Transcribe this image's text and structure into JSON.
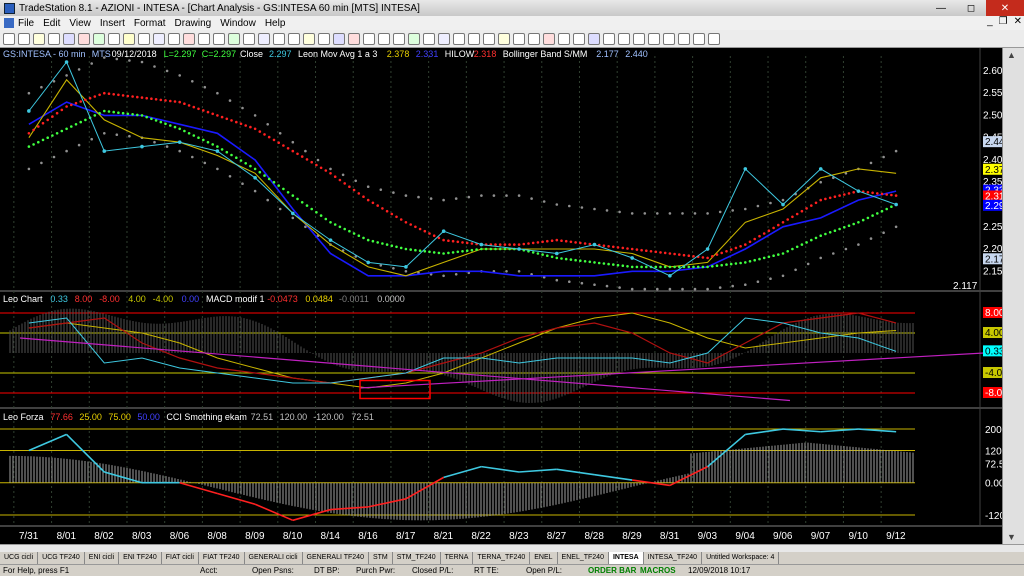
{
  "window": {
    "title": "TradeStation 8.1 - AZIONI - INTESA - [Chart Analysis - GS:INTESA  60 min  [MTS] INTESA]"
  },
  "menu": [
    "File",
    "Edit",
    "View",
    "Insert",
    "Format",
    "Drawing",
    "Window",
    "Help"
  ],
  "price_header": {
    "symbol": "GS:INTESA - 60 min",
    "exchange": "MTS",
    "date": "09/12/2018",
    "low": "L=2.297",
    "close_eq": "C=2.297",
    "close_label": "Close",
    "close_val": "2.297",
    "leon_label": "Leon Mov Avg 1 a 3",
    "leon_v1": "2.378",
    "leon_v2": "2.331",
    "hilow_label": "HILOW",
    "hilow_val": "2.318",
    "bb_label": "Bollinger Band S/MM",
    "bb_v1": "2.177",
    "bb_v2": "2.440"
  },
  "price_axis": [
    "2.6000",
    "2.5500",
    "2.5000",
    "2.4500",
    "2.4000",
    "2.3500",
    "2.3000",
    "2.2500",
    "2.2000",
    "2.1500"
  ],
  "price_markers": [
    {
      "label": "2.4400",
      "bg": "#c8d8f0",
      "fg": "#000"
    },
    {
      "label": "2.3780",
      "bg": "#ffff00",
      "fg": "#000"
    },
    {
      "label": "2.3310",
      "bg": "#0000ff",
      "fg": "#fff"
    },
    {
      "label": "2.3180",
      "bg": "#ff0000",
      "fg": "#fff"
    },
    {
      "label": "2.2970",
      "bg": "#0000ff",
      "fg": "#fff"
    },
    {
      "label": "2.1770",
      "bg": "#c8d8f0",
      "fg": "#000"
    }
  ],
  "price_low_label": "2.117",
  "osc_header": {
    "name": "Leo Chart",
    "v1": "0.33",
    "v2": "8.00",
    "v3": "-8.00",
    "v4": "4.00",
    "v5": "-4.00",
    "v6": "0.00",
    "macd_label": "MACD modif 1",
    "m1": "-0.0473",
    "m2": "0.0484",
    "m3": "-0.0011",
    "m4": "0.0000"
  },
  "osc_markers": [
    {
      "label": "8.00",
      "bg": "#ff0000",
      "fg": "#fff"
    },
    {
      "label": "4.00",
      "bg": "#c8c800",
      "fg": "#000"
    },
    {
      "label": "0.33",
      "bg": "#00ffff",
      "fg": "#000"
    },
    {
      "label": "-4.00",
      "bg": "#c8c800",
      "fg": "#000"
    },
    {
      "label": "-8.00",
      "bg": "#ff0000",
      "fg": "#fff"
    }
  ],
  "cci_header": {
    "name": "Leo Forza",
    "v1": "77.66",
    "v2": "25.00",
    "v3": "75.00",
    "v4": "50.00",
    "cci_label": "CCI Smothing ekam",
    "c1": "72.51",
    "c2": "120.00",
    "c3": "-120.00",
    "c4": "72.51"
  },
  "cci_axis": [
    {
      "label": "200.00",
      "bg": "#000",
      "fg": "#fff"
    },
    {
      "label": "120.00",
      "bg": "#000",
      "fg": "#fff"
    },
    {
      "label": "72.51",
      "bg": "#000",
      "fg": "#fff"
    },
    {
      "label": "0.00",
      "bg": "#000",
      "fg": "#fff"
    },
    {
      "label": "-120.00",
      "bg": "#000",
      "fg": "#fff"
    }
  ],
  "x_axis": [
    "7/31",
    "8/01",
    "8/02",
    "8/03",
    "8/06",
    "8/08",
    "8/09",
    "8/10",
    "8/14",
    "8/16",
    "8/17",
    "8/21",
    "8/22",
    "8/23",
    "8/27",
    "8/28",
    "8/29",
    "8/31",
    "9/03",
    "9/04",
    "9/06",
    "9/07",
    "9/10",
    "9/12"
  ],
  "tabs": [
    "UCG cicli",
    "UCG TF240",
    "ENI cicli",
    "ENI TF240",
    "FIAT cicli",
    "FIAT TF240",
    "GENERALI cicli",
    "GENERALI TF240",
    "STM",
    "STM_TF240",
    "TERNA",
    "TERNA_TF240",
    "ENEL",
    "ENEL_TF240",
    "INTESA",
    "INTESA_TF240",
    "Untitled Workspace: 4"
  ],
  "active_tab": "INTESA",
  "status": {
    "help": "For Help, press F1",
    "acct": "Acct:",
    "open_psns": "Open Psns:",
    "dt_bp": "DT BP:",
    "purch_pwr": "Purch Pwr:",
    "closed_pl": "Closed P/L:",
    "rt_te": "RT TE:",
    "open_pl": "Open P/L:",
    "order_bar": "ORDER BAR",
    "macros": "MACROS",
    "datetime": "12/09/2018 10:17"
  },
  "colors": {
    "close_line": "#3ec8e0",
    "mov_avg_yellow": "#c8b400",
    "mov_avg_blue": "#1a1aff",
    "hilow_red": "#ff2020",
    "bb_green": "#40ff40",
    "bb_gray": "#a0a0a0"
  },
  "chart_data": {
    "type": "line",
    "x": [
      "7/31",
      "8/01",
      "8/02",
      "8/03",
      "8/06",
      "8/08",
      "8/09",
      "8/10",
      "8/14",
      "8/16",
      "8/17",
      "8/21",
      "8/22",
      "8/23",
      "8/27",
      "8/28",
      "8/29",
      "8/31",
      "9/03",
      "9/04",
      "9/06",
      "9/07",
      "9/10",
      "9/12"
    ],
    "ylim": [
      2.117,
      2.62
    ],
    "series": [
      {
        "name": "Close",
        "values": [
          2.51,
          2.62,
          2.42,
          2.43,
          2.44,
          2.42,
          2.36,
          2.28,
          2.22,
          2.17,
          2.16,
          2.24,
          2.21,
          2.2,
          2.19,
          2.21,
          2.18,
          2.14,
          2.2,
          2.38,
          2.3,
          2.38,
          2.33,
          2.3
        ]
      },
      {
        "name": "Leon Mov Avg 1 a 3",
        "values": [
          2.45,
          2.58,
          2.49,
          2.45,
          2.44,
          2.41,
          2.37,
          2.28,
          2.21,
          2.16,
          2.14,
          2.17,
          2.2,
          2.2,
          2.2,
          2.2,
          2.19,
          2.16,
          2.17,
          2.26,
          2.29,
          2.36,
          2.38,
          2.37
        ]
      },
      {
        "name": "Leon Mov Avg 1 a 3 (2)",
        "values": [
          2.48,
          2.53,
          2.5,
          2.5,
          2.48,
          2.46,
          2.4,
          2.29,
          2.19,
          2.14,
          2.14,
          2.15,
          2.15,
          2.14,
          2.14,
          2.14,
          2.15,
          2.15,
          2.16,
          2.2,
          2.25,
          2.27,
          2.31,
          2.33
        ]
      },
      {
        "name": "HILOW",
        "values": [
          2.46,
          2.52,
          2.55,
          2.54,
          2.53,
          2.5,
          2.47,
          2.42,
          2.37,
          2.31,
          2.26,
          2.22,
          2.21,
          2.21,
          2.22,
          2.21,
          2.2,
          2.19,
          2.18,
          2.21,
          2.26,
          2.31,
          2.33,
          2.32
        ]
      },
      {
        "name": "Bollinger Band S/MM",
        "values": [
          2.43,
          2.47,
          2.51,
          2.5,
          2.47,
          2.43,
          2.38,
          2.32,
          2.26,
          2.22,
          2.2,
          2.19,
          2.2,
          2.2,
          2.18,
          2.17,
          2.16,
          2.16,
          2.16,
          2.17,
          2.19,
          2.23,
          2.26,
          2.3
        ]
      }
    ]
  }
}
